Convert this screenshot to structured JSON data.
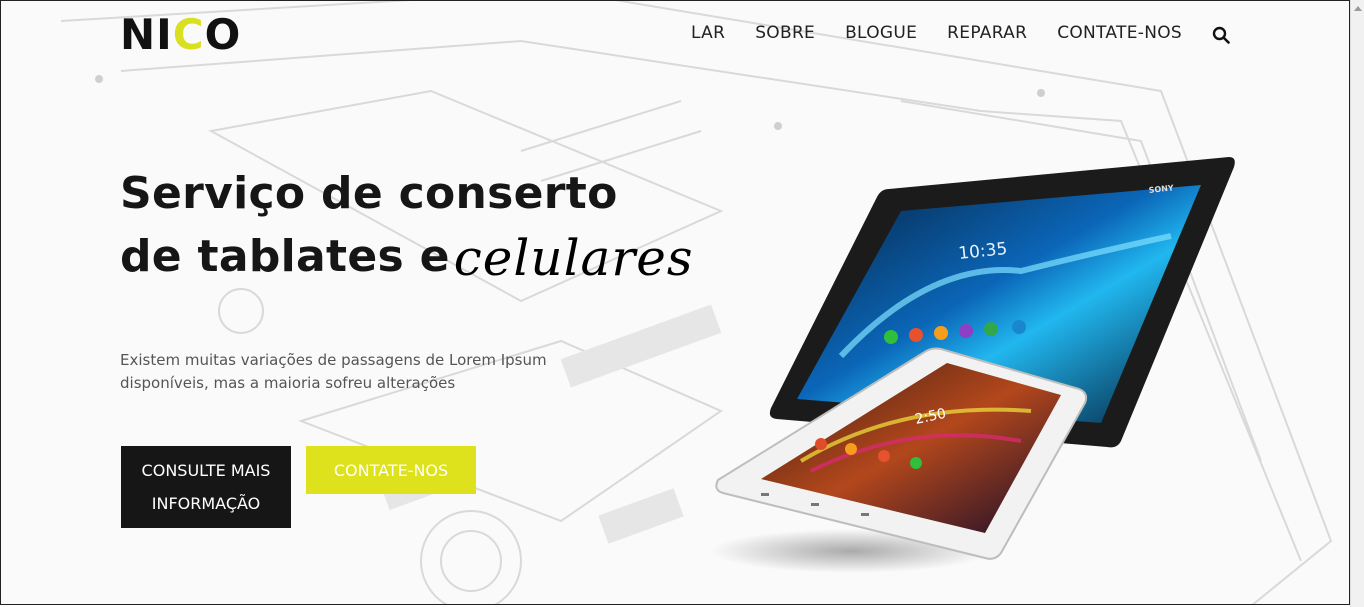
{
  "header": {
    "logo_pre": "NI",
    "logo_c": "C",
    "logo_post": "O",
    "nav": [
      "LAR",
      "SOBRE",
      "BLOGUE",
      "REPARAR",
      "CONTATE-NOS"
    ],
    "search_icon": "search-icon"
  },
  "hero": {
    "title_line1": "Serviço de conserto",
    "title_line2": "de tablates e",
    "title_highlight": "celulares",
    "description": "Existem muitas variações de passagens de Lorem Ipsum disponíveis, mas a maioria sofreu alterações",
    "btn_primary": "CONSULTE MAIS INFORMAÇÃO",
    "btn_secondary": "CONTATE-NOS",
    "tablet_brand": "SONY",
    "tablet_time": "10:35",
    "phone_time": "2:50"
  },
  "colors": {
    "accent": "#dde21c",
    "dark": "#161616"
  }
}
